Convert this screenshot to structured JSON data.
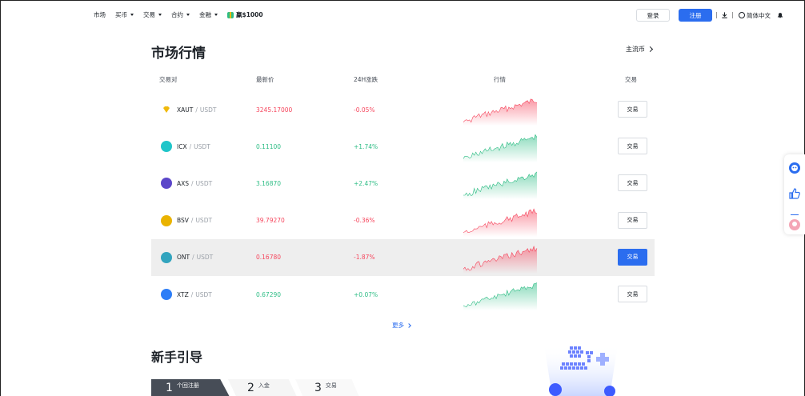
{
  "nav": {
    "items": [
      {
        "label": "市场",
        "dropdown": false
      },
      {
        "label": "买币",
        "dropdown": true
      },
      {
        "label": "交易",
        "dropdown": true
      },
      {
        "label": "合约",
        "dropdown": true
      },
      {
        "label": "金融",
        "dropdown": true
      }
    ],
    "promo_label": "赢$1000",
    "login_label": "登录",
    "signup_label": "注册",
    "language_label": "简体中文"
  },
  "market": {
    "title": "市场行情",
    "mainstream_link": "主流币",
    "columns": {
      "pair": "交易对",
      "price": "最新价",
      "change": "24H涨跌",
      "chart": "行情",
      "trade": "交易"
    },
    "rows": [
      {
        "base": "XAUT",
        "quote": "USDT",
        "price": "3245.17000",
        "change": "-0.05%",
        "direction": "down",
        "icon": "xaut-gold-icon",
        "icon_color": "#f0b90b",
        "highlighted": false,
        "trade_label": "交易"
      },
      {
        "base": "ICX",
        "quote": "USDT",
        "price": "0.11100",
        "change": "+1.74%",
        "direction": "up",
        "icon": "icx-icon",
        "icon_color": "#1fc5c9",
        "highlighted": false,
        "trade_label": "交易"
      },
      {
        "base": "AXS",
        "quote": "USDT",
        "price": "3.16870",
        "change": "+2.47%",
        "direction": "up",
        "icon": "axs-icon",
        "icon_color": "#5b46c9",
        "highlighted": false,
        "trade_label": "交易"
      },
      {
        "base": "BSV",
        "quote": "USDT",
        "price": "39.79270",
        "change": "-0.36%",
        "direction": "down",
        "icon": "bsv-icon",
        "icon_color": "#eab300",
        "highlighted": false,
        "trade_label": "交易"
      },
      {
        "base": "ONT",
        "quote": "USDT",
        "price": "0.16780",
        "change": "-1.87%",
        "direction": "down",
        "icon": "ont-icon",
        "icon_color": "#32a4be",
        "highlighted": true,
        "trade_label": "交易"
      },
      {
        "base": "XTZ",
        "quote": "USDT",
        "price": "0.67290",
        "change": "+0.07%",
        "direction": "up",
        "icon": "xtz-icon",
        "icon_color": "#2c7df7",
        "highlighted": false,
        "trade_label": "交易"
      }
    ],
    "more_label": "更多"
  },
  "guide": {
    "title": "新手引导",
    "steps": [
      {
        "num": "1",
        "label": "个回注册"
      },
      {
        "num": "2",
        "label": "入金"
      },
      {
        "num": "3",
        "label": "交易"
      }
    ]
  },
  "colors": {
    "accent": "#2b6def",
    "up": "#2ebd85",
    "down": "#f6465d",
    "highlight_row": "#eeeeee"
  }
}
